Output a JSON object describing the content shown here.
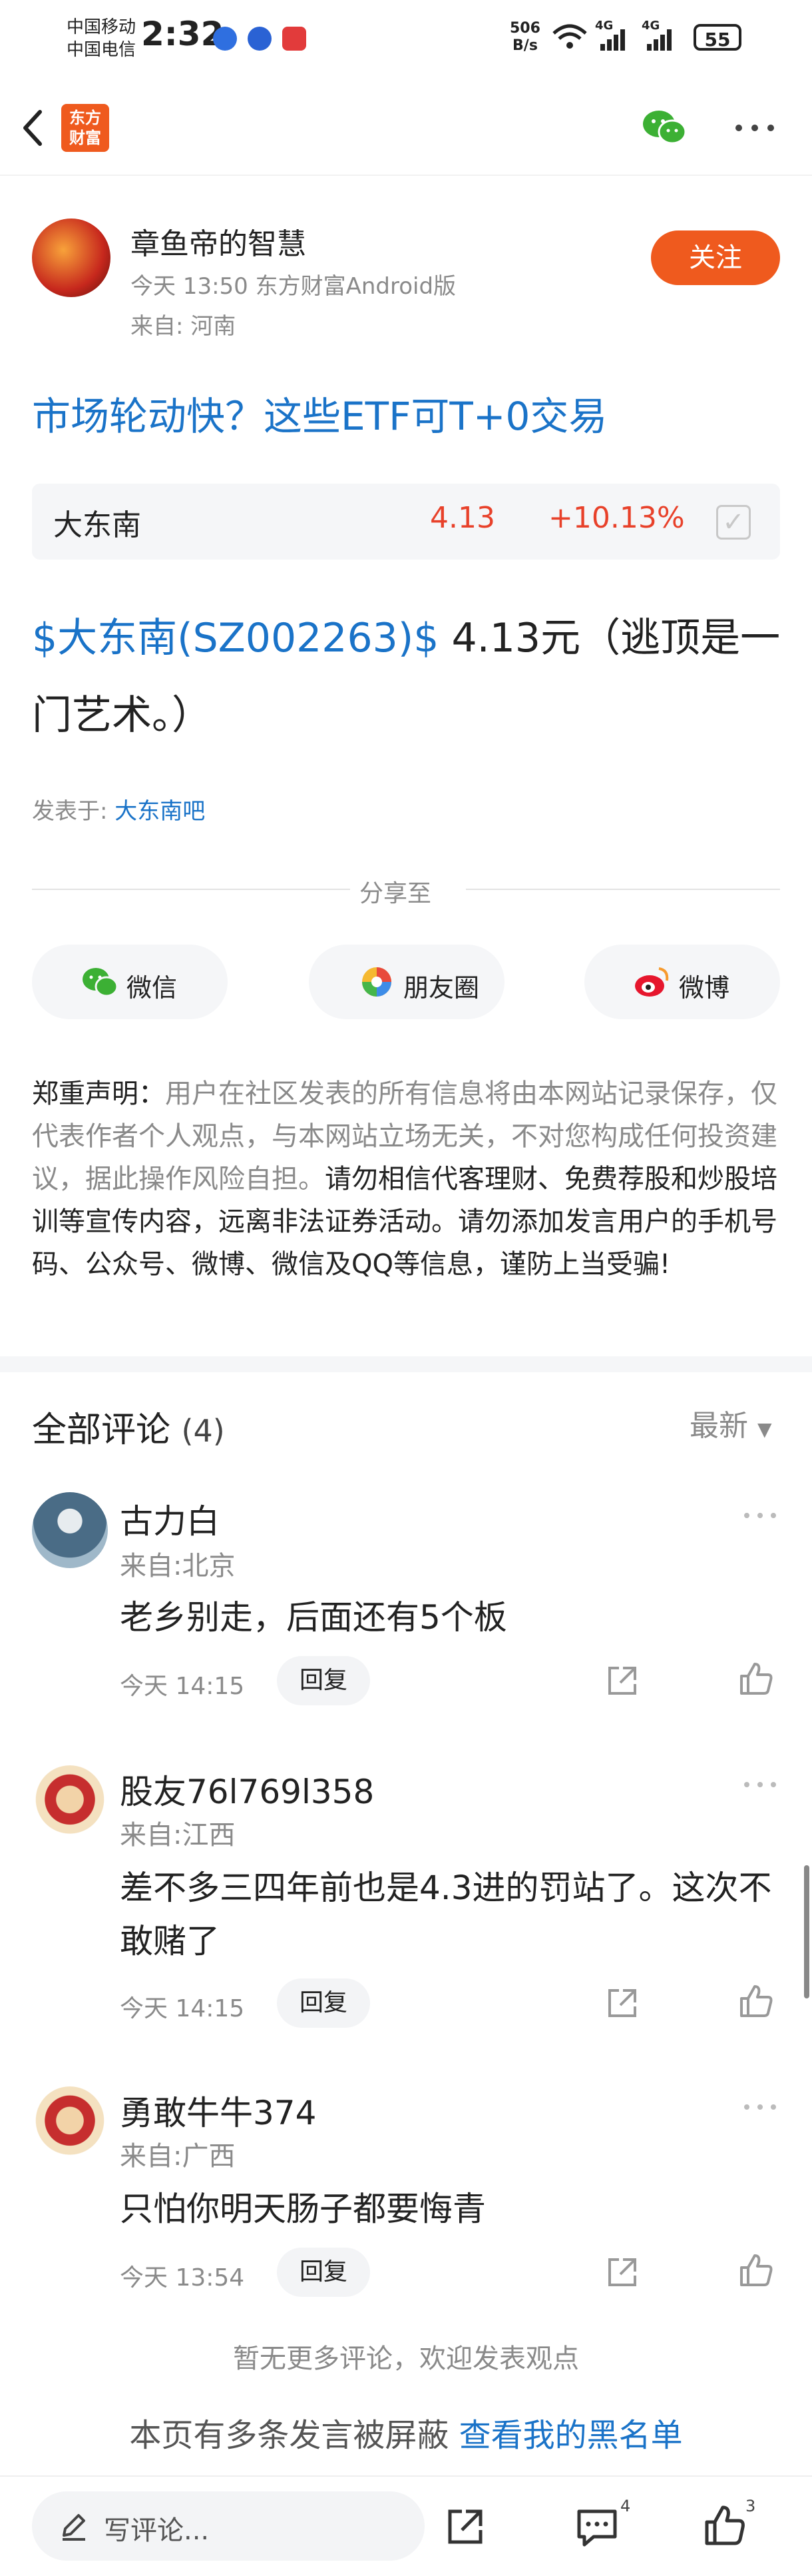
{
  "status_bar": {
    "carrier_1": "中国移动",
    "carrier_2": "中国电信",
    "time": "2:32",
    "net_speed_value": "506",
    "net_speed_unit": "B/s",
    "signal_1": "4G",
    "signal_2": "4G",
    "battery": "55"
  },
  "nav": {
    "logo_line1": "东方",
    "logo_line2": "财富"
  },
  "author": {
    "name": "章鱼帝的智慧",
    "meta": "今天 13:50 东方财富Android版",
    "location": "来自: 河南",
    "follow_label": "关注"
  },
  "post": {
    "title": "市场轮动快？这些ETF可T+0交易",
    "stock_link": "$大东南(SZ002263)$",
    "body_text": " 4.13元（逃顶是一门艺术。）",
    "posted_in_label": "发表于:",
    "posted_in_bar": "大东南吧"
  },
  "stock_card": {
    "name": "大东南",
    "price": "4.13",
    "change": "+10.13%",
    "accent": "#e8412a"
  },
  "share": {
    "label": "分享至",
    "wechat": "微信",
    "moments": "朋友圈",
    "weibo": "微博"
  },
  "disclaimer": {
    "heading": "郑重声明：",
    "text_gray": "用户在社区发表的所有信息将由本网站记录保存，仅代表作者个人观点，与本网站立场无关，不对您构成任何投资建议，据此操作风险自担。",
    "text_strong": "请勿相信代客理财、免费荐股和炒股培训等宣传内容，远离非法证券活动。请勿添加发言用户的手机号码、公众号、微博、微信及QQ等信息，谨防上当受骗!"
  },
  "comments": {
    "title": "全部评论",
    "count": "(4)",
    "sort_label": "最新",
    "reply_label": "回复",
    "items": [
      {
        "name": "古力白",
        "location": "来自:北京",
        "text": "老乡别走，后面还有5个板",
        "time": "今天 14:15"
      },
      {
        "name": "股友76l769l358",
        "location": "来自:江西",
        "text": "差不多三四年前也是4.3进的罚站了。这次不敢赌了",
        "time": "今天 14:15"
      },
      {
        "name": "勇敢牛牛374",
        "location": "来自:广西",
        "text": "只怕你明天肠子都要悔青",
        "time": "今天 13:54"
      }
    ],
    "no_more": "暂无更多评论，欢迎发表观点",
    "blocked_text": "本页有多条发言被屏蔽 ",
    "blocked_link": "查看我的黑名单"
  },
  "bottom_bar": {
    "write_placeholder": "写评论...",
    "comment_count": "4",
    "like_count": "3"
  }
}
